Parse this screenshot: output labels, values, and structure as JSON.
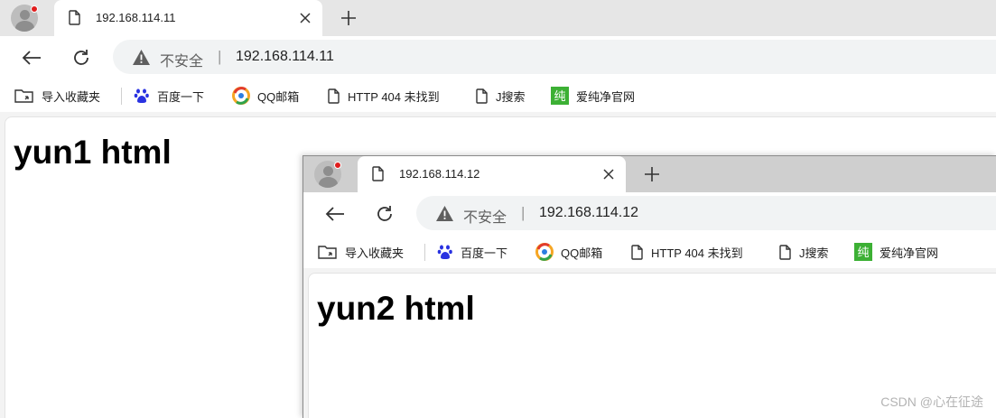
{
  "browsers": [
    {
      "tab_title": "192.168.114.11",
      "security_label": "不安全",
      "separator": "|",
      "url": "192.168.114.11",
      "page_heading": "yun1 html"
    },
    {
      "tab_title": "192.168.114.12",
      "security_label": "不安全",
      "separator": "|",
      "url": "192.168.114.12",
      "page_heading": "yun2 html"
    }
  ],
  "bookmarks": [
    {
      "label": "导入收藏夹",
      "icon": "folder-import-icon"
    },
    {
      "label": "百度一下",
      "icon": "baidu-paw-icon"
    },
    {
      "label": "QQ邮箱",
      "icon": "qqmail-icon"
    },
    {
      "label": "HTTP 404 未找到",
      "icon": "page-icon"
    },
    {
      "label": "J搜索",
      "icon": "page-icon"
    },
    {
      "label": "爱纯净官网",
      "icon": "green-square-icon",
      "icon_text": "纯"
    }
  ],
  "watermark": "CSDN @心在征途",
  "colors": {
    "tabstrip_back": "#e6e6e6",
    "tabstrip_front": "#cfcfcf",
    "profile_badge": "#e01e1e",
    "omnibox": "#f1f3f4",
    "baidu_blue": "#2932e1",
    "green_badge": "#3cb034"
  }
}
